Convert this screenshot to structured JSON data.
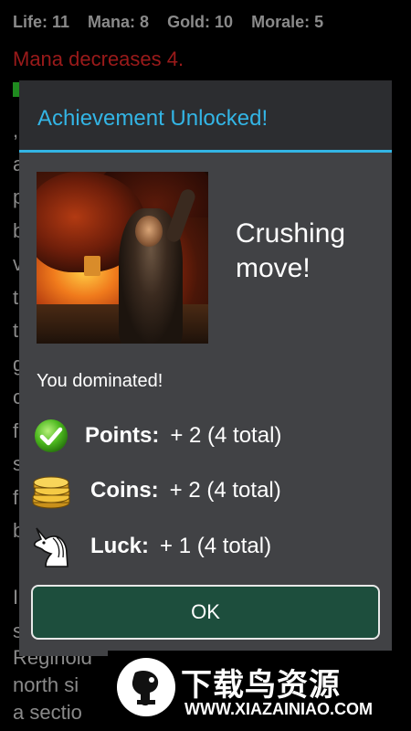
{
  "stats": {
    "life": "Life: 11",
    "mana": "Mana: 8",
    "gold": "Gold: 10",
    "morale": "Morale: 5"
  },
  "background": {
    "message": "Mana decreases 4.",
    "partial_letters": [
      ",",
      "a",
      "p",
      "b",
      "v",
      "t",
      "t",
      "g",
      "c",
      "f",
      "s",
      "f",
      "b",
      "",
      "I",
      "s"
    ],
    "bottom_lines": [
      "Reginold",
      "north si",
      "a sectio"
    ]
  },
  "dialog": {
    "title": "Achievement Unlocked!",
    "achievement_name": "Crushing move!",
    "subtitle": "You dominated!",
    "rewards": [
      {
        "icon": "checkmark-icon",
        "label": "Points:",
        "value": "+ 2 (4 total)"
      },
      {
        "icon": "coins-icon",
        "label": "Coins:",
        "value": "+ 2 (4 total)"
      },
      {
        "icon": "unicorn-icon",
        "label": "Luck:",
        "value": "+ 1 (4 total)"
      }
    ],
    "ok_label": "OK"
  },
  "watermark": {
    "title": "下载鸟资源",
    "url": "WWW.XIAZAINIAO.COM"
  },
  "colors": {
    "accent": "#33b5e5",
    "dialog_bg": "#414245",
    "header_bg": "#2c2d30",
    "button_bg": "#1d4e3d",
    "warning_text": "#9a1a1a"
  }
}
